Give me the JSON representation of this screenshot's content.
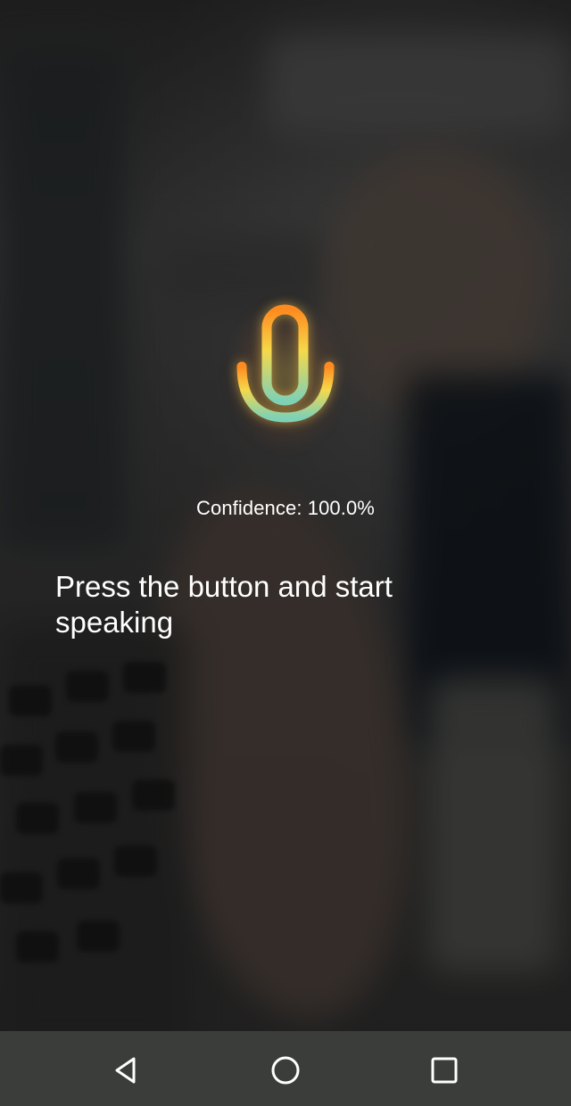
{
  "screen": {
    "confidence_text": "Confidence: 100.0%",
    "prompt_text": "Press the button and start speaking"
  },
  "icons": {
    "microphone": "microphone-icon",
    "back": "back-triangle-icon",
    "home": "home-circle-icon",
    "recents": "recents-square-icon"
  },
  "colors": {
    "text": "#ffffff",
    "navigation_bar": "#3b3d3a",
    "mic_top": "#ff8a1f",
    "mic_middle": "#f5d84a",
    "mic_bottom": "#7fd1b6"
  }
}
